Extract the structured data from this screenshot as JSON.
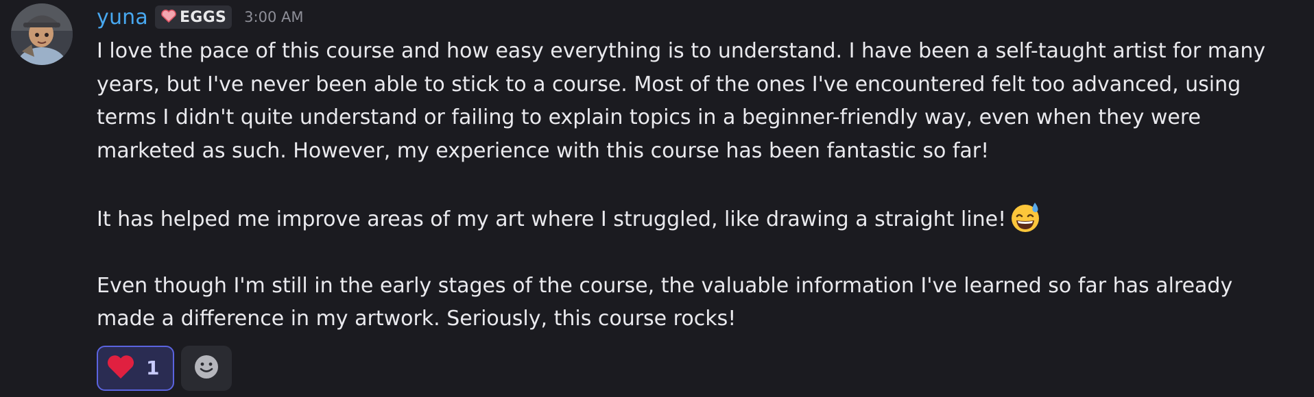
{
  "message": {
    "author": "yuna",
    "tag": {
      "icon": "heart-icon",
      "label": "EGGS"
    },
    "timestamp": "3:00 AM",
    "paragraphs": [
      "I love the pace of this course and how easy everything is to understand. I have been a self-taught artist for many years, but I've never been able to stick to a course. Most of the ones I've encountered felt too advanced, using terms I didn't quite understand or failing to explain topics in a beginner-friendly way, even when they were marketed as such. However, my experience with this course has been fantastic so far!",
      "It has helped me improve areas of my art where I struggled, like drawing a straight line!",
      "Even though I'm still in the early stages of the course, the valuable information I've learned so far has already made a difference in my artwork. Seriously, this course rocks!"
    ],
    "inline_emoji": "grinning-sweat-emoji",
    "reactions": [
      {
        "emoji": "heart-icon",
        "count": "1"
      },
      {
        "emoji": "add-reaction-icon"
      }
    ]
  },
  "colors": {
    "background": "#1b1b20",
    "username": "#48a8f0",
    "text": "#eaeaee",
    "timestamp": "#8e8f98",
    "reaction_active_border": "#5b64e0",
    "reaction_active_bg": "#2a2c52"
  }
}
